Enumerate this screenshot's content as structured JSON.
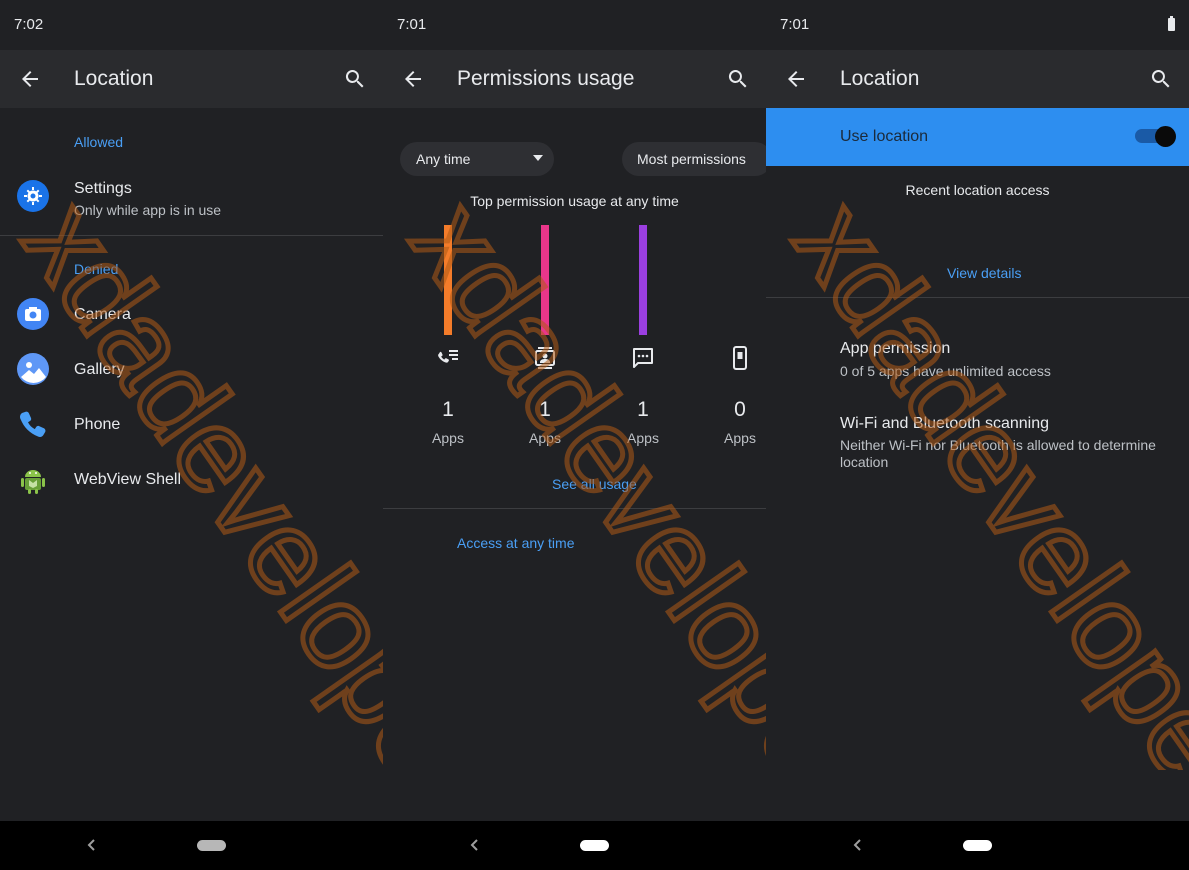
{
  "panels": [
    {
      "time": "7:02",
      "title": "Location",
      "allowed_label": "Allowed",
      "allowed_item": {
        "title": "Settings",
        "subtitle": "Only while app is in use"
      },
      "denied_label": "Denied",
      "denied_items": [
        {
          "title": "Camera"
        },
        {
          "title": "Gallery"
        },
        {
          "title": "Phone"
        },
        {
          "title": "WebView Shell"
        }
      ]
    },
    {
      "time": "7:01",
      "title": "Permissions usage",
      "filter_time": "Any time",
      "filter_sort": "Most permissions",
      "chart_title": "Top permission usage at any time",
      "see_all": "See all usage",
      "access_link": "Access at any time"
    },
    {
      "time": "7:01",
      "title": "Location",
      "use_location": "Use location",
      "recent_access": "Recent location access",
      "view_details": "View details",
      "app_permission": {
        "title": "App permission",
        "subtitle": "0 of 5 apps have unlimited access"
      },
      "scanning": {
        "title": "Wi-Fi and Bluetooth scanning",
        "subtitle": "Neither Wi-Fi nor Bluetooth is allowed to determine location"
      }
    }
  ],
  "chart_data": {
    "type": "bar",
    "title": "Top permission usage at any time",
    "categories": [
      "call-log",
      "contacts",
      "sms",
      "phone"
    ],
    "series": [
      {
        "values": [
          1,
          1,
          1,
          0
        ]
      }
    ],
    "unit_label": "Apps",
    "colors": [
      "#f47c2a",
      "#e9368a",
      "#9b3fe0",
      "#9e9e9e"
    ]
  },
  "watermark": "xdadevelopers",
  "colors": {
    "accent": "#4a9ff5",
    "toggle_bar": "#2d8ef0",
    "background": "#202124",
    "appbar": "#2a2b2e"
  }
}
